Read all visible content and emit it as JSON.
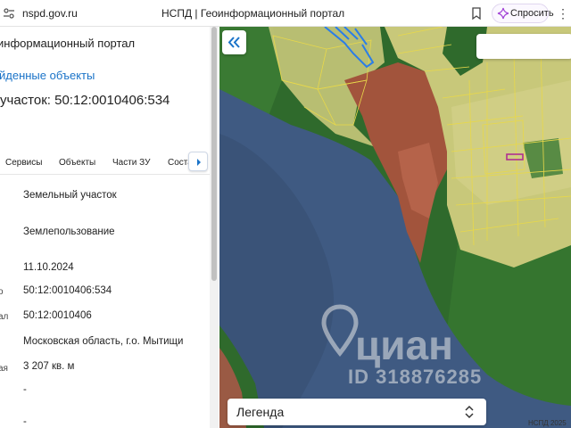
{
  "browser": {
    "url": "nspd.gov.ru",
    "tab_title": "НСПД | Геоинформационный портал",
    "ask_label": "Спросить",
    "icons": [
      "site-info-icon",
      "bookmark-icon",
      "sparkle-icon",
      "more-icon"
    ]
  },
  "panel": {
    "portal_title": "информационный портал",
    "found_link": "йденные объекты",
    "parcel_title": "участок: 50:12:0010406:534",
    "tabs": [
      "Сервисы",
      "Объекты",
      "Части ЗУ",
      "Соста"
    ],
    "properties": [
      {
        "label": "",
        "value": "Земельный участок"
      },
      {
        "label": "",
        "value": "Землепользование"
      },
      {
        "label": "",
        "value": "11.10.2024"
      },
      {
        "label": "о",
        "value": "50:12:0010406:534"
      },
      {
        "label": "ал",
        "value": "50:12:0010406"
      },
      {
        "label": "",
        "value": "Московская область, г.о. Мытищи"
      },
      {
        "label": "ая",
        "value": "3 207 кв. м"
      },
      {
        "label": "",
        "value": "-"
      },
      {
        "label": "",
        "value": "-"
      }
    ]
  },
  "map": {
    "legend_label": "Легенда",
    "watermark_brand": "циан",
    "watermark_id": "ID 318876285",
    "credit": "НСПД 2025",
    "colors": {
      "water": "#3f5a82",
      "forest": "#2f6a2c",
      "field": "#c8c87a",
      "urban": "#a2543c",
      "parcel_outline": "#e8d84a",
      "selected_parcel": "#b03090",
      "blue_parcels": "#2a7de8"
    }
  }
}
